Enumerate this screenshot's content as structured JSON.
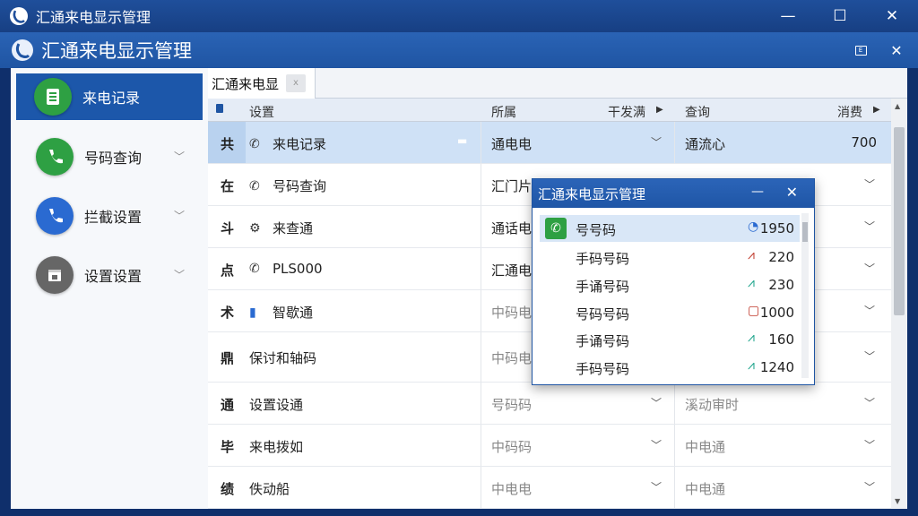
{
  "window": {
    "title": "汇通来电显示管理"
  },
  "header": {
    "title": "汇通来电显示管理"
  },
  "sidebar": {
    "items": [
      {
        "label": "来电记录",
        "icon": "call-log-icon",
        "color": "#2ea043"
      },
      {
        "label": "号码查询",
        "icon": "phone-icon",
        "color": "#2ea043"
      },
      {
        "label": "拦截设置",
        "icon": "phone-icon",
        "color": "#2a6ad1"
      },
      {
        "label": "设置设置",
        "icon": "calendar-icon",
        "color": "#666666"
      }
    ]
  },
  "tab": {
    "label": "汇通来电显"
  },
  "table": {
    "headers": [
      "设置",
      "所属",
      "干发满",
      "查询",
      "消费"
    ],
    "rows": [
      {
        "idx": "共",
        "name": "来电记录",
        "icon": "phone-icon",
        "col2": "通电电",
        "col3": "通流心",
        "col4": "700"
      },
      {
        "idx": "在",
        "name": "号码查询",
        "icon": "phone-icon",
        "col2": "汇门片",
        "col3": "",
        "col4": ""
      },
      {
        "idx": "斗",
        "name": "来查通",
        "icon": "gear-icon",
        "col2": "通话电",
        "col3": "",
        "col4": ""
      },
      {
        "idx": "点",
        "name": "PLS000",
        "icon": "phone-icon",
        "col2": "汇通电",
        "col3": "",
        "col4": ""
      },
      {
        "idx": "术",
        "name": "智歇通",
        "icon": "document-icon",
        "col2": "中码电",
        "col3": "",
        "col4": ""
      },
      {
        "idx": "鼎",
        "name": "保讨和轴码",
        "icon": "",
        "col2": "中码电",
        "col3": "",
        "col4": ""
      },
      {
        "idx": "通",
        "name": "设置设通",
        "icon": "",
        "col2": "号码码",
        "col3": "溪动审时",
        "col4": ""
      },
      {
        "idx": "毕",
        "name": "来电拨如",
        "icon": "",
        "col2": "中码码",
        "col3": "中电通",
        "col4": ""
      },
      {
        "idx": "绩",
        "name": "佚动船",
        "icon": "",
        "col2": "中电电",
        "col3": "中电通",
        "col4": ""
      }
    ]
  },
  "popup": {
    "title": "汇通来电显示管理",
    "rows": [
      {
        "label": "号号码",
        "icon": "clock-icon",
        "value": "1950"
      },
      {
        "label": "手码号码",
        "icon": "signal-icon",
        "value": "220"
      },
      {
        "label": "手诵号码",
        "icon": "signal-icon",
        "value": "230"
      },
      {
        "label": "号码号码",
        "icon": "box-icon",
        "value": "1000"
      },
      {
        "label": "手诵号码",
        "icon": "signal-icon",
        "value": "160"
      },
      {
        "label": "手码号码",
        "icon": "signal-icon",
        "value": "1240"
      }
    ]
  }
}
